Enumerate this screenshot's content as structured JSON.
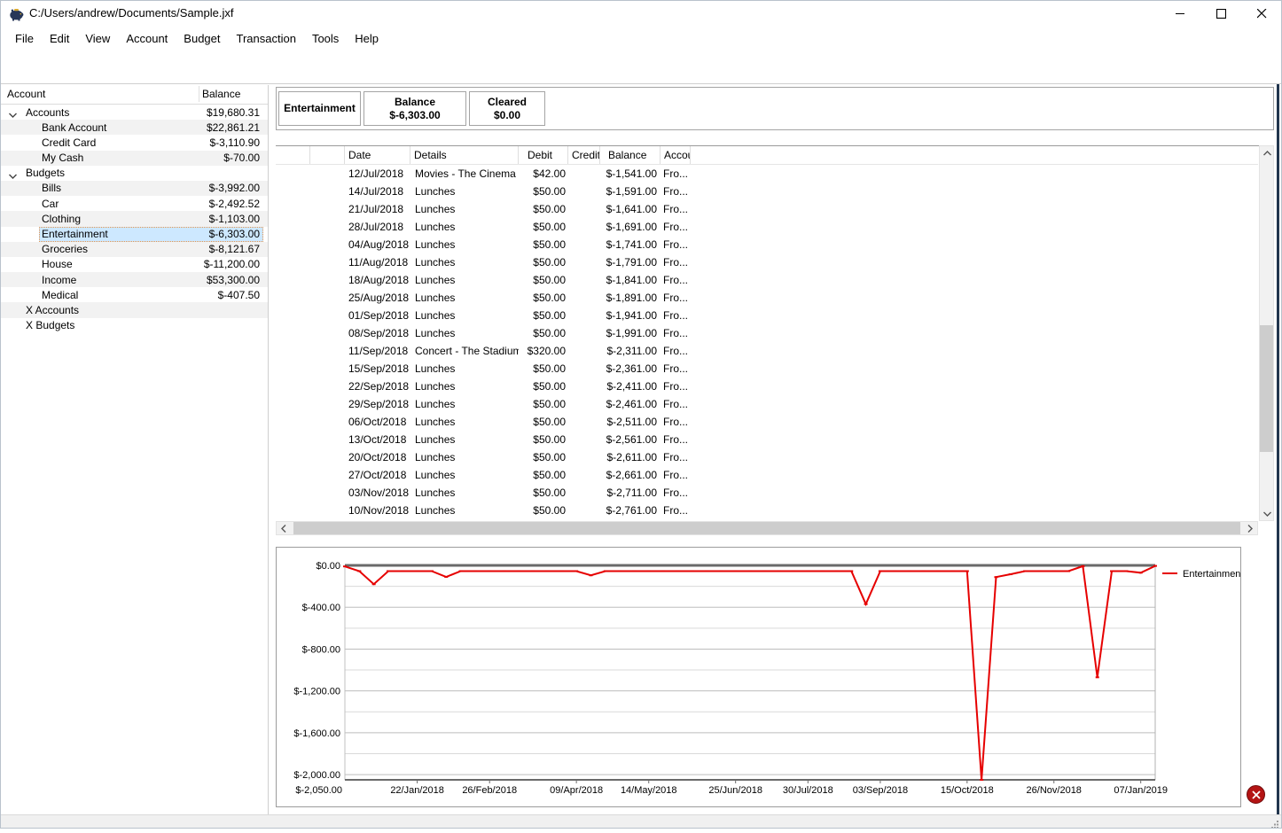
{
  "window": {
    "title": "C:/Users/andrew/Documents/Sample.jxf",
    "controls": {
      "minimize": "–",
      "maximize": "□",
      "close": "✕"
    }
  },
  "menu": {
    "items": [
      "File",
      "Edit",
      "View",
      "Account",
      "Budget",
      "Transaction",
      "Tools",
      "Help"
    ]
  },
  "toolbar": {
    "left_icons": [
      "help-icon",
      "add-account-coin-icon",
      "remove-account-coin-icon",
      "transfer-coins-icon",
      "budget-apple-icon",
      "search-icon",
      "hamburger-menu-icon"
    ],
    "register_icons": [
      "help-icon",
      "add-transaction-icon",
      "transaction-dropdown-icon",
      "edit-transaction-icon",
      "transaction-report-icon"
    ],
    "right_icons": [
      "reconcile-icon"
    ]
  },
  "sidebar": {
    "columns": {
      "account": "Account",
      "balance": "Balance"
    },
    "rows": [
      {
        "label": "Accounts",
        "balance": "$19,680.31",
        "level": 0,
        "chevron": true,
        "selected": false
      },
      {
        "label": "Bank Account",
        "balance": "$22,861.21",
        "level": 1,
        "chevron": false,
        "selected": false
      },
      {
        "label": "Credit Card",
        "balance": "$-3,110.90",
        "level": 1,
        "chevron": false,
        "selected": false
      },
      {
        "label": "My Cash",
        "balance": "$-70.00",
        "level": 1,
        "chevron": false,
        "selected": false
      },
      {
        "label": "Budgets",
        "balance": "",
        "level": 0,
        "chevron": true,
        "selected": false
      },
      {
        "label": "Bills",
        "balance": "$-3,992.00",
        "level": 1,
        "chevron": false,
        "selected": false
      },
      {
        "label": "Car",
        "balance": "$-2,492.52",
        "level": 1,
        "chevron": false,
        "selected": false
      },
      {
        "label": "Clothing",
        "balance": "$-1,103.00",
        "level": 1,
        "chevron": false,
        "selected": false
      },
      {
        "label": "Entertainment",
        "balance": "$-6,303.00",
        "level": 1,
        "chevron": false,
        "selected": true
      },
      {
        "label": "Groceries",
        "balance": "$-8,121.67",
        "level": 1,
        "chevron": false,
        "selected": false
      },
      {
        "label": "House",
        "balance": "$-11,200.00",
        "level": 1,
        "chevron": false,
        "selected": false
      },
      {
        "label": "Income",
        "balance": "$53,300.00",
        "level": 1,
        "chevron": false,
        "selected": false
      },
      {
        "label": "Medical",
        "balance": "$-407.50",
        "level": 1,
        "chevron": false,
        "selected": false
      },
      {
        "label": "X Accounts",
        "balance": "",
        "level": 0,
        "chevron": false,
        "selected": false
      },
      {
        "label": "X Budgets",
        "balance": "",
        "level": 0,
        "chevron": false,
        "selected": false
      }
    ]
  },
  "register": {
    "account_tab": "Entertainment",
    "balance_box": {
      "label": "Balance",
      "value": "$-6,303.00"
    },
    "cleared_box": {
      "label": "Cleared",
      "value": "$0.00"
    },
    "table": {
      "columns": [
        "",
        "",
        "Date",
        "Details",
        "Debit",
        "Credit",
        "Balance",
        "Account"
      ],
      "rows": [
        {
          "date": "12/Jul/2018",
          "details": "Movies - The Cinema",
          "debit": "$42.00",
          "credit": "",
          "balance": "$-1,541.00",
          "account": "Fro..."
        },
        {
          "date": "14/Jul/2018",
          "details": "Lunches",
          "debit": "$50.00",
          "credit": "",
          "balance": "$-1,591.00",
          "account": "Fro..."
        },
        {
          "date": "21/Jul/2018",
          "details": "Lunches",
          "debit": "$50.00",
          "credit": "",
          "balance": "$-1,641.00",
          "account": "Fro..."
        },
        {
          "date": "28/Jul/2018",
          "details": "Lunches",
          "debit": "$50.00",
          "credit": "",
          "balance": "$-1,691.00",
          "account": "Fro..."
        },
        {
          "date": "04/Aug/2018",
          "details": "Lunches",
          "debit": "$50.00",
          "credit": "",
          "balance": "$-1,741.00",
          "account": "Fro..."
        },
        {
          "date": "11/Aug/2018",
          "details": "Lunches",
          "debit": "$50.00",
          "credit": "",
          "balance": "$-1,791.00",
          "account": "Fro..."
        },
        {
          "date": "18/Aug/2018",
          "details": "Lunches",
          "debit": "$50.00",
          "credit": "",
          "balance": "$-1,841.00",
          "account": "Fro..."
        },
        {
          "date": "25/Aug/2018",
          "details": "Lunches",
          "debit": "$50.00",
          "credit": "",
          "balance": "$-1,891.00",
          "account": "Fro..."
        },
        {
          "date": "01/Sep/2018",
          "details": "Lunches",
          "debit": "$50.00",
          "credit": "",
          "balance": "$-1,941.00",
          "account": "Fro..."
        },
        {
          "date": "08/Sep/2018",
          "details": "Lunches",
          "debit": "$50.00",
          "credit": "",
          "balance": "$-1,991.00",
          "account": "Fro..."
        },
        {
          "date": "11/Sep/2018",
          "details": "Concert - The Stadium",
          "debit": "$320.00",
          "credit": "",
          "balance": "$-2,311.00",
          "account": "Fro..."
        },
        {
          "date": "15/Sep/2018",
          "details": "Lunches",
          "debit": "$50.00",
          "credit": "",
          "balance": "$-2,361.00",
          "account": "Fro..."
        },
        {
          "date": "22/Sep/2018",
          "details": "Lunches",
          "debit": "$50.00",
          "credit": "",
          "balance": "$-2,411.00",
          "account": "Fro..."
        },
        {
          "date": "29/Sep/2018",
          "details": "Lunches",
          "debit": "$50.00",
          "credit": "",
          "balance": "$-2,461.00",
          "account": "Fro..."
        },
        {
          "date": "06/Oct/2018",
          "details": "Lunches",
          "debit": "$50.00",
          "credit": "",
          "balance": "$-2,511.00",
          "account": "Fro..."
        },
        {
          "date": "13/Oct/2018",
          "details": "Lunches",
          "debit": "$50.00",
          "credit": "",
          "balance": "$-2,561.00",
          "account": "Fro..."
        },
        {
          "date": "20/Oct/2018",
          "details": "Lunches",
          "debit": "$50.00",
          "credit": "",
          "balance": "$-2,611.00",
          "account": "Fro..."
        },
        {
          "date": "27/Oct/2018",
          "details": "Lunches",
          "debit": "$50.00",
          "credit": "",
          "balance": "$-2,661.00",
          "account": "Fro..."
        },
        {
          "date": "03/Nov/2018",
          "details": "Lunches",
          "debit": "$50.00",
          "credit": "",
          "balance": "$-2,711.00",
          "account": "Fro..."
        },
        {
          "date": "10/Nov/2018",
          "details": "Lunches",
          "debit": "$50.00",
          "credit": "",
          "balance": "$-2,761.00",
          "account": "Fro..."
        }
      ]
    }
  },
  "chart_data": {
    "type": "line",
    "title": "",
    "legend_position": "right",
    "grid": true,
    "x_unit": "week (values estimated from plot; weekly spending totals)",
    "ylim": [
      -2050,
      0
    ],
    "gridline_step": 200,
    "y_ticks": [
      {
        "value": 0,
        "label": "$0.00"
      },
      {
        "value": -400,
        "label": "$-400.00"
      },
      {
        "value": -800,
        "label": "$-800.00"
      },
      {
        "value": -1200,
        "label": "$-1,200.00"
      },
      {
        "value": -1600,
        "label": "$-1,600.00"
      },
      {
        "value": -2000,
        "label": "$-2,000.00"
      }
    ],
    "y_axis_min_label": "$-2,050.00",
    "x_ticks": [
      {
        "index": 5,
        "label": "22/Jan/2018"
      },
      {
        "index": 10,
        "label": "26/Feb/2018"
      },
      {
        "index": 16,
        "label": "09/Apr/2018"
      },
      {
        "index": 21,
        "label": "14/May/2018"
      },
      {
        "index": 27,
        "label": "25/Jun/2018"
      },
      {
        "index": 32,
        "label": "30/Jul/2018"
      },
      {
        "index": 37,
        "label": "03/Sep/2018"
      },
      {
        "index": 43,
        "label": "15/Oct/2018"
      },
      {
        "index": 49,
        "label": "26/Nov/2018"
      },
      {
        "index": 55,
        "label": "07/Jan/2019"
      }
    ],
    "series": [
      {
        "name": "Entertainment",
        "color": "#e60000",
        "values": [
          -10,
          -55,
          -180,
          -55,
          -55,
          -55,
          -55,
          -110,
          -55,
          -55,
          -55,
          -55,
          -55,
          -55,
          -55,
          -55,
          -55,
          -95,
          -55,
          -55,
          -55,
          -55,
          -55,
          -55,
          -55,
          -55,
          -55,
          -55,
          -55,
          -55,
          -55,
          -55,
          -55,
          -55,
          -55,
          -55,
          -370,
          -55,
          -55,
          -55,
          -55,
          -55,
          -55,
          -55,
          -2050,
          -112,
          -85,
          -55,
          -55,
          -55,
          -55,
          -8,
          -1070,
          -55,
          -55,
          -70,
          -5
        ]
      }
    ]
  },
  "status_bar": {
    "text": ""
  }
}
